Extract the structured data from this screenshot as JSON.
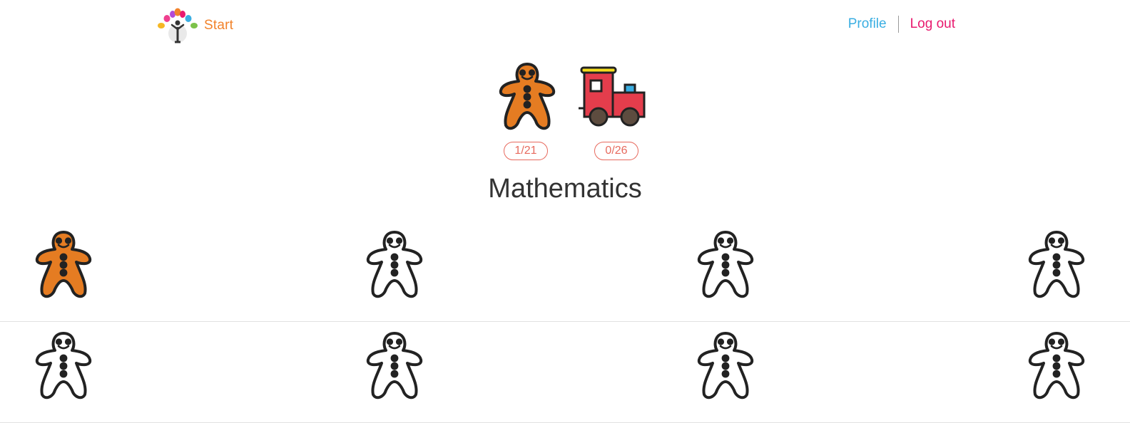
{
  "navbar": {
    "brand_label": "Start",
    "profile_label": "Profile",
    "logout_label": "Log out"
  },
  "badges": [
    {
      "name": "gingerbread",
      "progress": "1/21",
      "earned": 1,
      "total": 21
    },
    {
      "name": "train",
      "progress": "0/26",
      "earned": 0,
      "total": 26
    }
  ],
  "page": {
    "title": "Mathematics"
  },
  "grid": {
    "rows": [
      {
        "items": [
          {
            "state": "completed"
          },
          {
            "state": "outline"
          },
          {
            "state": "outline"
          },
          {
            "state": "outline"
          }
        ]
      },
      {
        "items": [
          {
            "state": "outline"
          },
          {
            "state": "outline"
          },
          {
            "state": "outline"
          },
          {
            "state": "outline"
          }
        ]
      }
    ]
  },
  "colors": {
    "accent_orange": "#f2822a",
    "link_blue": "#3aaee2",
    "logout_pink": "#e8196e",
    "pill_red": "#e76a5e",
    "gingerbread_fill": "#e57c22",
    "train_red": "#e43d4c"
  },
  "icons": {
    "brand": "tree-logo-icon",
    "badge_gingerbread": "gingerbread-man-icon",
    "badge_train": "train-icon",
    "tile": "gingerbread-man-icon"
  }
}
